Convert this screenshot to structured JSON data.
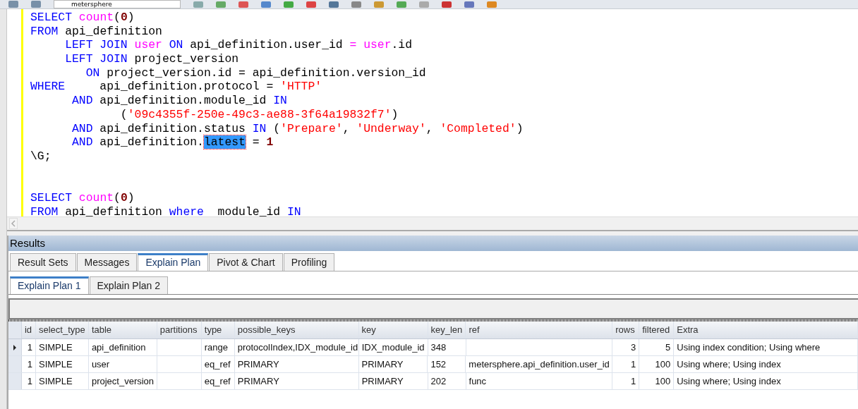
{
  "toolbar": {
    "database": "metersphere"
  },
  "editor": {
    "lines": [
      [
        {
          "kind": "keyword",
          "text": "SELECT"
        },
        {
          "kind": "function",
          "text": " count"
        },
        {
          "kind": "plain",
          "text": "("
        },
        {
          "kind": "number",
          "text": "0"
        },
        {
          "kind": "plain",
          "text": ")"
        }
      ],
      [
        {
          "kind": "keyword",
          "text": "FROM"
        },
        {
          "kind": "plain",
          "text": " api_definition"
        }
      ],
      [
        {
          "kind": "keyword",
          "text": "     LEFT JOIN"
        },
        {
          "kind": "function",
          "text": " user"
        },
        {
          "kind": "keyword",
          "text": " ON"
        },
        {
          "kind": "plain",
          "text": " api_definition.user_id"
        },
        {
          "kind": "function",
          "text": " ="
        },
        {
          "kind": "function",
          "text": " user"
        },
        {
          "kind": "plain",
          "text": ".id"
        }
      ],
      [
        {
          "kind": "keyword",
          "text": "     LEFT JOIN"
        },
        {
          "kind": "plain",
          "text": " project_version"
        }
      ],
      [
        {
          "kind": "keyword",
          "text": "        ON"
        },
        {
          "kind": "plain",
          "text": " project_version.id = api_definition.version_id"
        }
      ],
      [
        {
          "kind": "keyword",
          "text": "WHERE"
        },
        {
          "kind": "plain",
          "text": "     api_definition.protocol = "
        },
        {
          "kind": "string",
          "text": "'HTTP'"
        }
      ],
      [
        {
          "kind": "keyword",
          "text": "      AND"
        },
        {
          "kind": "plain",
          "text": " api_definition.module_id "
        },
        {
          "kind": "keyword",
          "text": "IN"
        }
      ],
      [
        {
          "kind": "plain",
          "text": "             ("
        },
        {
          "kind": "string",
          "text": "'09c4355f-250e-49c3-ae88-3f64a19832f7'"
        },
        {
          "kind": "plain",
          "text": ")"
        }
      ],
      [
        {
          "kind": "keyword",
          "text": "      AND"
        },
        {
          "kind": "plain",
          "text": " api_definition.status "
        },
        {
          "kind": "keyword",
          "text": "IN"
        },
        {
          "kind": "plain",
          "text": " ("
        },
        {
          "kind": "string",
          "text": "'Prepare'"
        },
        {
          "kind": "plain",
          "text": ", "
        },
        {
          "kind": "string",
          "text": "'Underway'"
        },
        {
          "kind": "plain",
          "text": ", "
        },
        {
          "kind": "string",
          "text": "'Completed'"
        },
        {
          "kind": "plain",
          "text": ")"
        }
      ],
      [
        {
          "kind": "keyword",
          "text": "      AND"
        },
        {
          "kind": "plain",
          "text": " api_definition."
        },
        {
          "kind": "selection",
          "text": "latest"
        },
        {
          "kind": "plain",
          "text": " = "
        },
        {
          "kind": "number",
          "text": "1"
        }
      ],
      [
        {
          "kind": "plain",
          "text": "\\G;"
        }
      ],
      {
        "kind": "blank"
      },
      {
        "kind": "blank"
      },
      [
        {
          "kind": "keyword",
          "text": "SELECT"
        },
        {
          "kind": "function",
          "text": " count"
        },
        {
          "kind": "plain",
          "text": "("
        },
        {
          "kind": "number",
          "text": "0"
        },
        {
          "kind": "plain",
          "text": ")"
        }
      ],
      [
        {
          "kind": "keyword",
          "text": "FROM"
        },
        {
          "kind": "plain",
          "text": " api_definition "
        },
        {
          "kind": "keyword",
          "text": "where"
        },
        {
          "kind": "plain",
          "text": "  module_id "
        },
        {
          "kind": "keyword",
          "text": "IN"
        }
      ]
    ]
  },
  "results": {
    "title": "Results",
    "tabs": [
      {
        "label": "Result Sets",
        "selected": false
      },
      {
        "label": "Messages",
        "selected": false
      },
      {
        "label": "Explain Plan",
        "selected": true
      },
      {
        "label": "Pivot & Chart",
        "selected": false
      },
      {
        "label": "Profiling",
        "selected": false
      }
    ],
    "subtabs": [
      {
        "label": "Explain Plan 1",
        "selected": true
      },
      {
        "label": "Explain Plan 2",
        "selected": false
      }
    ],
    "table": {
      "columns": [
        "id",
        "select_type",
        "table",
        "partitions",
        "type",
        "possible_keys",
        "key",
        "key_len",
        "ref",
        "rows",
        "filtered",
        "Extra"
      ],
      "rows": [
        {
          "current": true,
          "cells": [
            "1",
            "SIMPLE",
            "api_definition",
            "",
            "range",
            "protocolIndex,IDX_module_id",
            "IDX_module_id",
            "348",
            "",
            "3",
            "5",
            "Using index condition; Using where"
          ]
        },
        {
          "current": false,
          "cells": [
            "1",
            "SIMPLE",
            "user",
            "",
            "eq_ref",
            "PRIMARY",
            "PRIMARY",
            "152",
            "metersphere.api_definition.user_id",
            "1",
            "100",
            "Using where; Using index"
          ]
        },
        {
          "current": false,
          "cells": [
            "1",
            "SIMPLE",
            "project_version",
            "",
            "eq_ref",
            "PRIMARY",
            "PRIMARY",
            "202",
            "func",
            "1",
            "100",
            "Using where; Using index"
          ]
        }
      ]
    }
  }
}
